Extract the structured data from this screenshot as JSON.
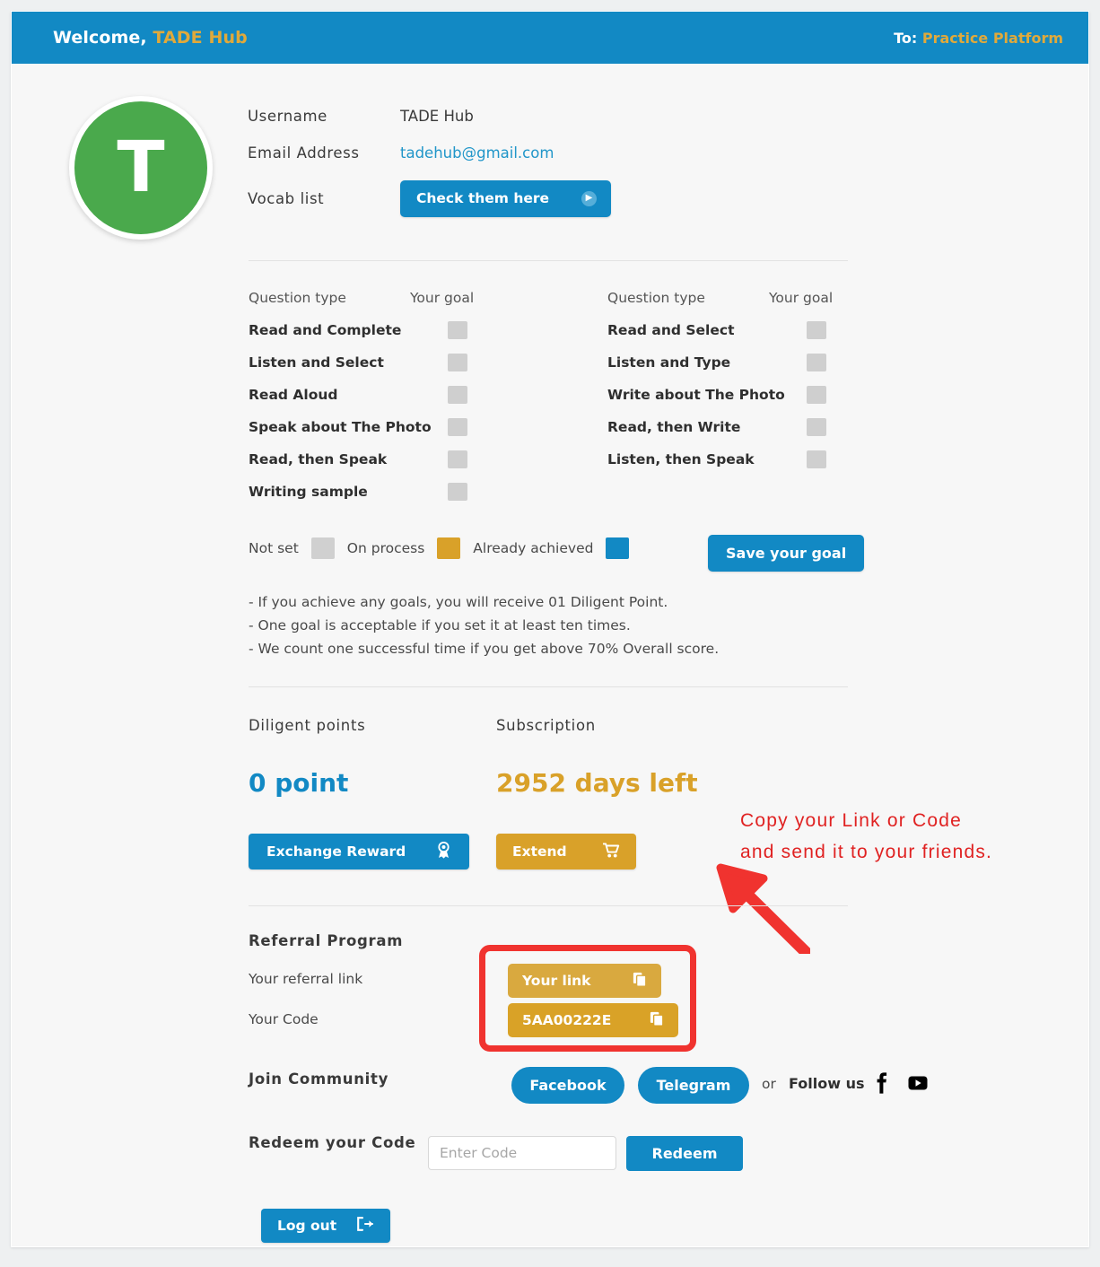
{
  "header": {
    "welcome_prefix": "Welcome,",
    "username": "TADE Hub",
    "to_label": "To:",
    "platform": "Practice Platform"
  },
  "profile": {
    "avatar_initial": "T",
    "username_label": "Username",
    "username_value": "TADE Hub",
    "email_label": "Email Address",
    "email_value": "tadehub@gmail.com",
    "vocab_label": "Vocab list",
    "vocab_button": "Check them here"
  },
  "goals": {
    "col_header_type": "Question type",
    "col_header_goal": "Your goal",
    "left": [
      "Read and Complete",
      "Listen and Select",
      "Read Aloud",
      "Speak about The Photo",
      "Read, then Speak",
      "Writing sample"
    ],
    "right": [
      "Read and Select",
      "Listen and Type",
      "Write about The Photo",
      "Read, then Write",
      "Listen, then Speak"
    ],
    "legend": {
      "not_set": "Not set",
      "on_process": "On process",
      "already_achieved": "Already achieved",
      "color_not_set": "#d0d0d0",
      "color_on_process": "#d9a129",
      "color_achieved": "#1289c4"
    },
    "save_button": "Save your goal",
    "notes": [
      "- If you achieve any goals, you will receive 01 Diligent Point.",
      "- One goal is acceptable if you set it at least ten times.",
      "- We count one successful time if you get above 70% Overall score."
    ]
  },
  "points": {
    "diligent_label": "Diligent points",
    "diligent_value": "0 point",
    "exchange_button": "Exchange Reward",
    "subscription_label": "Subscription",
    "subscription_value": "2952 days left",
    "extend_button": "Extend"
  },
  "annotation": {
    "line1": "Copy your Link or Code",
    "line2": "and send it to your friends.",
    "color": "#e02222",
    "box_color": "#f0332f"
  },
  "referral": {
    "heading": "Referral Program",
    "link_label": "Your referral link",
    "link_button": "Your link",
    "code_label": "Your Code",
    "code_button": "5AA00222E"
  },
  "community": {
    "heading": "Join Community",
    "facebook_button": "Facebook",
    "telegram_button": "Telegram",
    "or_text": "or",
    "follow_text": "Follow us"
  },
  "redeem": {
    "heading": "Redeem your Code",
    "placeholder": "Enter Code",
    "value": "",
    "button": "Redeem"
  },
  "logout": {
    "label": "Log out"
  }
}
